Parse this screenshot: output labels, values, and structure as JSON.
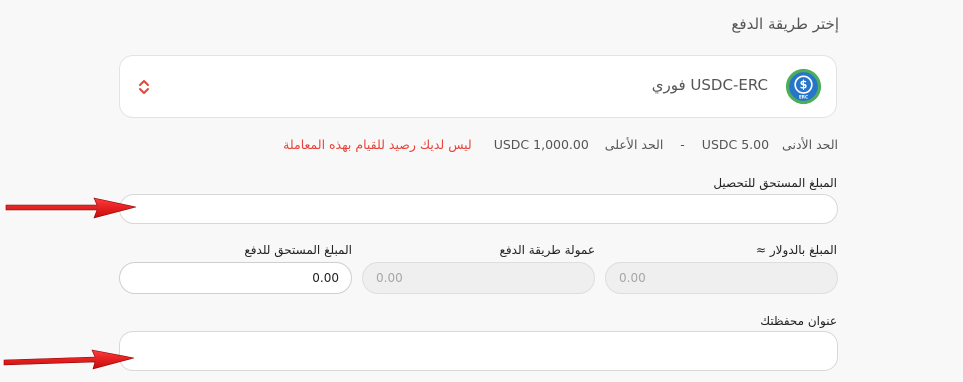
{
  "payment": {
    "section_title": "إختر طريقة الدفع",
    "method": {
      "label": "USDC-ERC فوري",
      "icon": "usdc-coin-icon",
      "icon_text": "ERC",
      "selector_icon": "chevron-up-down-icon"
    },
    "limits": {
      "min_label": "الحد الأدنى",
      "min_value": "5.00 USDC",
      "separator": "-",
      "max_label": "الحد الأعلى",
      "max_value": "1,000.00 USDC",
      "error": "ليس لديك رصيد للقيام بهذه المعاملة"
    },
    "amount_due_field": {
      "label": "المبلغ المستحق للتحصيل",
      "value": ""
    },
    "usd_amount": {
      "label": "المبلغ بالدولار ≈",
      "value": "0.00"
    },
    "method_fee": {
      "label": "عمولة طريقة الدفع",
      "value": "0.00"
    },
    "amount_payable": {
      "label": "المبلغ المستحق للدفع",
      "value": "0.00"
    },
    "wallet_address": {
      "label": "عنوان محفظتك",
      "value": ""
    }
  },
  "colors": {
    "error": "#e5453a",
    "usdc_blue": "#2775ca",
    "usdc_ring": "#4cae5a",
    "arrow_red": "#e01010"
  }
}
